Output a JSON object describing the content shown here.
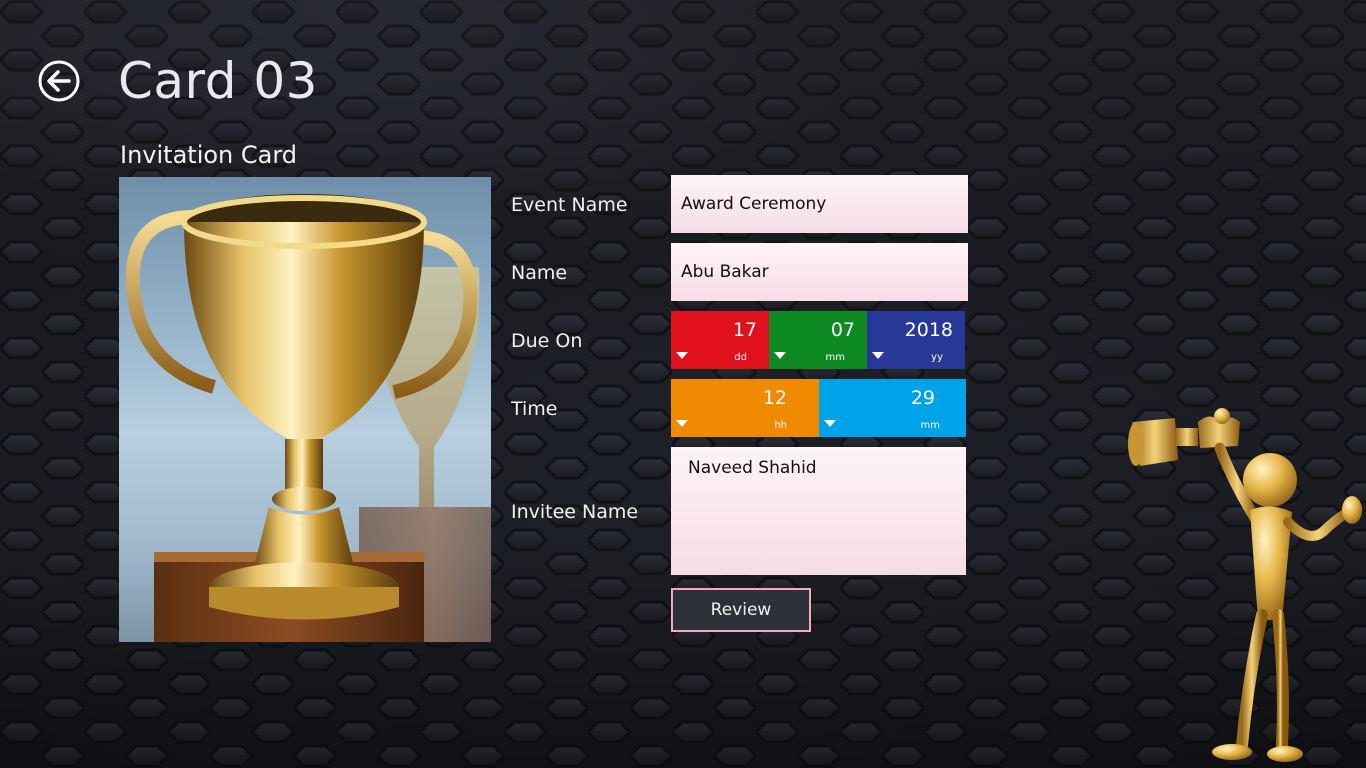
{
  "header": {
    "title": "Card 03",
    "back_icon": "arrow-left-circle-icon"
  },
  "section": {
    "title": "Invitation Card"
  },
  "card_image": {
    "subject": "gold-trophy"
  },
  "form": {
    "event_name": {
      "label": "Event Name",
      "value": "Award Ceremony"
    },
    "name": {
      "label": "Name",
      "value": "Abu Bakar"
    },
    "due_on": {
      "label": "Due On",
      "day": {
        "value": "17",
        "unit": "dd",
        "color": "#e0101c"
      },
      "month": {
        "value": "07",
        "unit": "mm",
        "color": "#0e8a22"
      },
      "year": {
        "value": "2018",
        "unit": "yy",
        "color": "#283896"
      }
    },
    "time": {
      "label": "Time",
      "hour": {
        "value": "12",
        "unit": "hh",
        "color": "#f08a00"
      },
      "minute": {
        "value": "29",
        "unit": "mm",
        "color": "#00a2e8"
      }
    },
    "invitee_name": {
      "label": "Invitee Name",
      "value": "Naveed Shahid"
    },
    "review_label": "Review"
  },
  "colors": {
    "field_background": "#f9e4eb",
    "review_border": "#f3a9c3"
  },
  "decor": {
    "mascot": "gold-figure-holding-trophy"
  }
}
